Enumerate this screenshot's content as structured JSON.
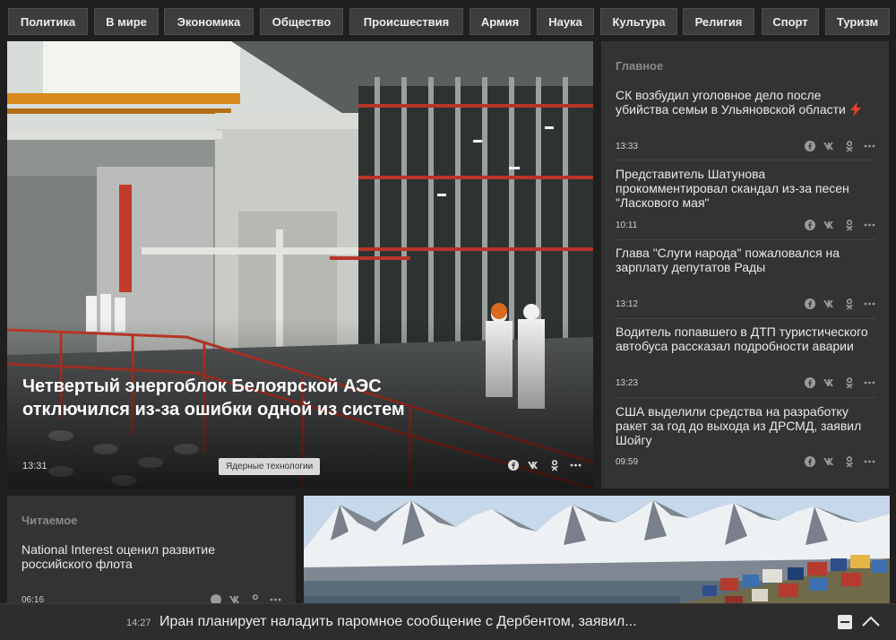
{
  "nav": {
    "items": [
      "Политика",
      "В мире",
      "Экономика",
      "Общество",
      "Происшествия",
      "Армия",
      "Наука",
      "Культура",
      "Религия",
      "Спорт",
      "Туризм"
    ]
  },
  "hero": {
    "title": "Четвертый энергоблок Белоярской АЭС отключился из-за ошибки одной из систем",
    "time": "13:31",
    "tag": "Ядерные технологии"
  },
  "main": {
    "heading": "Главное",
    "stories": [
      {
        "title": "СК возбудил уголовное дело после убийства семьи в Ульяновской области",
        "time": "13:33",
        "lightning": true
      },
      {
        "title": "Представитель Шатунова прокомментировал скандал из-за песен \"Ласкового мая\"",
        "time": "10:11"
      },
      {
        "title": "Глава \"Слуги народа\" пожаловался на зарплату депутатов Рады",
        "time": "13:12"
      },
      {
        "title": "Водитель попавшего в ДТП туристического автобуса рассказал подробности аварии",
        "time": "13:23"
      },
      {
        "title": "США выделили средства на разработку ракет за год до выхода из ДРСМД, заявил Шойгу",
        "time": "09:59"
      }
    ]
  },
  "read": {
    "heading": "Читаемое",
    "story_title": "National Interest оценил развитие российского флота",
    "story_time": "06:16"
  },
  "ticker": {
    "time": "14:27",
    "text": "Иран планирует наладить паромное сообщение с Дербентом, заявил..."
  },
  "share_icons": [
    "facebook-icon",
    "vk-icon",
    "ok-icon",
    "more-icon"
  ],
  "colors": {
    "background": "#1f1f1f",
    "panel": "#333333",
    "nav_button": "#3d3d3d",
    "lightning": "#e8412b"
  }
}
